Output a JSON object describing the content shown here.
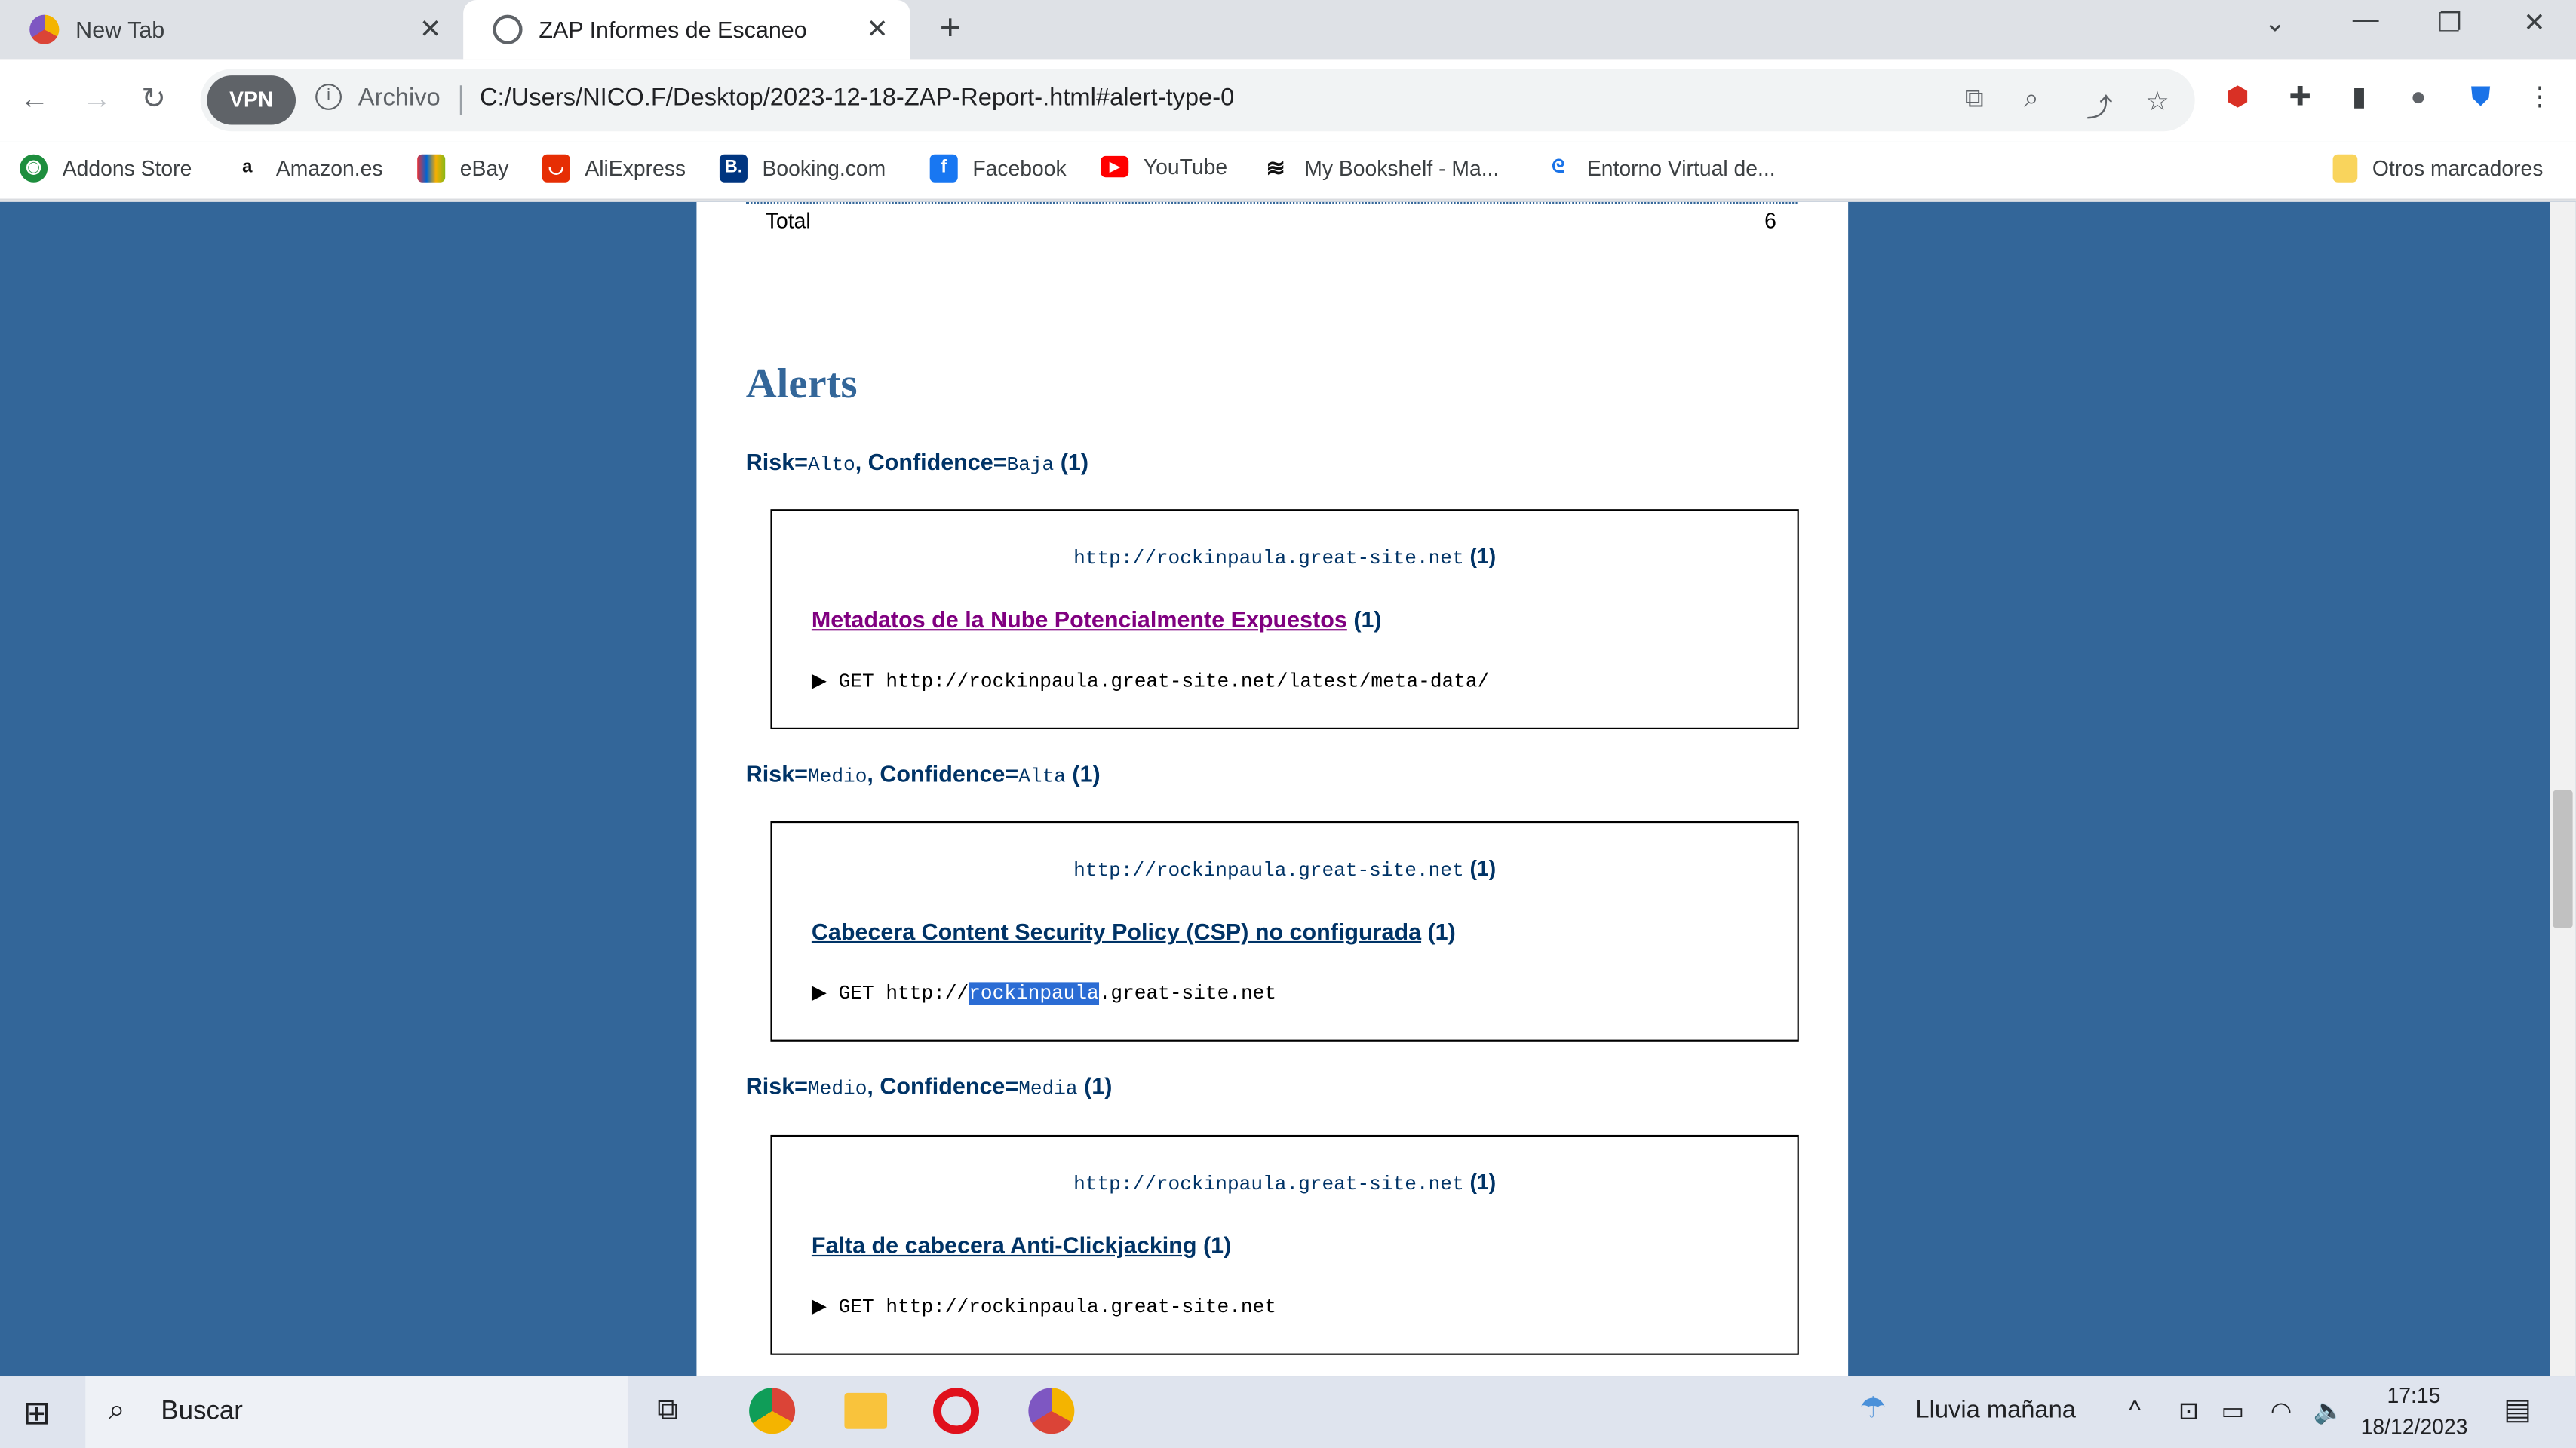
{
  "browser": {
    "tabs": [
      {
        "title": "New Tab",
        "active": false
      },
      {
        "title": "ZAP Informes de Escaneo",
        "active": true
      }
    ],
    "vpn_label": "VPN",
    "scheme_label": "Archivo",
    "url": "C:/Users/NICO.F/Desktop/2023-12-18-ZAP-Report-.html#alert-type-0"
  },
  "bookmarks": [
    {
      "label": "Addons Store",
      "icon": "addons-icon",
      "color": "#1e8e3e"
    },
    {
      "label": "Amazon.es",
      "icon": "amazon-icon",
      "color": "#111111"
    },
    {
      "label": "eBay",
      "icon": "ebay-icon",
      "color": "#e53238"
    },
    {
      "label": "AliExpress",
      "icon": "aliexpress-icon",
      "color": "#e62e04"
    },
    {
      "label": "Booking.com",
      "icon": "booking-icon",
      "color": "#003580"
    },
    {
      "label": "Facebook",
      "icon": "facebook-icon",
      "color": "#1877f2"
    },
    {
      "label": "YouTube",
      "icon": "youtube-icon",
      "color": "#ff0000"
    },
    {
      "label": "My Bookshelf - Ma...",
      "icon": "bookshelf-icon",
      "color": "#111111"
    },
    {
      "label": "Entorno Virtual de...",
      "icon": "entorno-icon",
      "color": "#1a73e8"
    }
  ],
  "other_bookmarks": "Otros marcadores",
  "report": {
    "total_label": "Total",
    "total_value": "6",
    "heading": "Alerts",
    "groups": [
      {
        "risk_label": "Risk=",
        "risk": "Alto",
        "conf_label": ", Confidence=",
        "conf": "Baja",
        "count": "(1)",
        "site": "http://rockinpaula.great-site.net",
        "site_count": "(1)",
        "alert": "Metadatos de la Nube Potencialmente Expuestos",
        "alert_count": "(1)",
        "request": "▶ GET http://rockinpaula.great-site.net/latest/meta-data/"
      },
      {
        "risk_label": "Risk=",
        "risk": "Medio",
        "conf_label": ", Confidence=",
        "conf": "Alta",
        "count": "(1)",
        "site": "http://rockinpaula.great-site.net",
        "site_count": "(1)",
        "alert": "Cabecera Content Security Policy (CSP) no configurada",
        "alert_count": "(1)",
        "request_pre": "▶ GET http://",
        "request_hl": "rockinpaula",
        "request_post": ".great-site.net"
      },
      {
        "risk_label": "Risk=",
        "risk": "Medio",
        "conf_label": ", Confidence=",
        "conf": "Media",
        "count": "(1)",
        "site": "http://rockinpaula.great-site.net",
        "site_count": "(1)",
        "alert": "Falta de cabecera Anti-Clickjacking",
        "alert_count": "(1)",
        "request": "▶ GET http://rockinpaula.great-site.net"
      }
    ]
  },
  "taskbar": {
    "search_placeholder": "Buscar",
    "weather": "Lluvia mañana",
    "time": "17:15",
    "date": "18/12/2023"
  }
}
